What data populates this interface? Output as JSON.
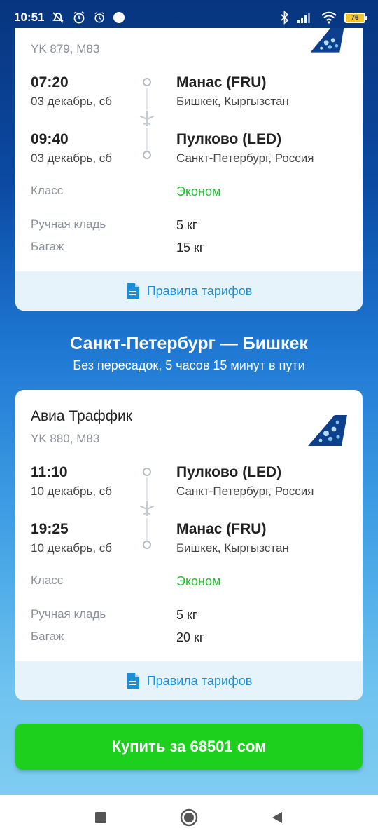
{
  "status_bar": {
    "time": "10:51",
    "battery": "76",
    "icons": [
      "muted-notifications-icon",
      "alarm-icon",
      "alarm-icon",
      "dot-icon",
      "bluetooth-icon",
      "signal-icon",
      "wifi-icon",
      "battery-icon"
    ]
  },
  "flights": [
    {
      "airline": "",
      "code": "YK 879, M83",
      "departure": {
        "time": "07:20",
        "date": "03 декабрь, сб",
        "airport": "Манас (FRU)",
        "city": "Бишкек, Кыргызстан"
      },
      "arrival": {
        "time": "09:40",
        "date": "03 декабрь, сб",
        "airport": "Пулково (LED)",
        "city": "Санкт-Петербург, Россия"
      },
      "class_label": "Класс",
      "class_value": "Эконом",
      "hand_label": "Ручная кладь",
      "hand_value": "5 кг",
      "bag_label": "Багаж",
      "bag_value": "15 кг",
      "rules_label": "Правила тарифов"
    },
    {
      "airline": "Авиа Траффик",
      "code": "YK 880, M83",
      "departure": {
        "time": "11:10",
        "date": "10 декабрь, сб",
        "airport": "Пулково (LED)",
        "city": "Санкт-Петербург, Россия"
      },
      "arrival": {
        "time": "19:25",
        "date": "10 декабрь, сб",
        "airport": "Манас (FRU)",
        "city": "Бишкек, Кыргызстан"
      },
      "class_label": "Класс",
      "class_value": "Эконом",
      "hand_label": "Ручная кладь",
      "hand_value": "5 кг",
      "bag_label": "Багаж",
      "bag_value": "20 кг",
      "rules_label": "Правила тарифов"
    }
  ],
  "return_route": {
    "title": "Санкт-Петербург — Бишкек",
    "subtitle": "Без пересадок, 5 часов 15 минут в пути"
  },
  "buy_button": "Купить за 68501 сом",
  "colors": {
    "accent_green": "#1ed01e",
    "class_green": "#1fbf2c",
    "link_blue": "#1a8fd8",
    "background_top": "#08357e",
    "background_bottom": "#86d0f2"
  },
  "nav": {
    "icons": [
      "recents-square-icon",
      "home-circle-icon",
      "back-triangle-icon"
    ]
  }
}
